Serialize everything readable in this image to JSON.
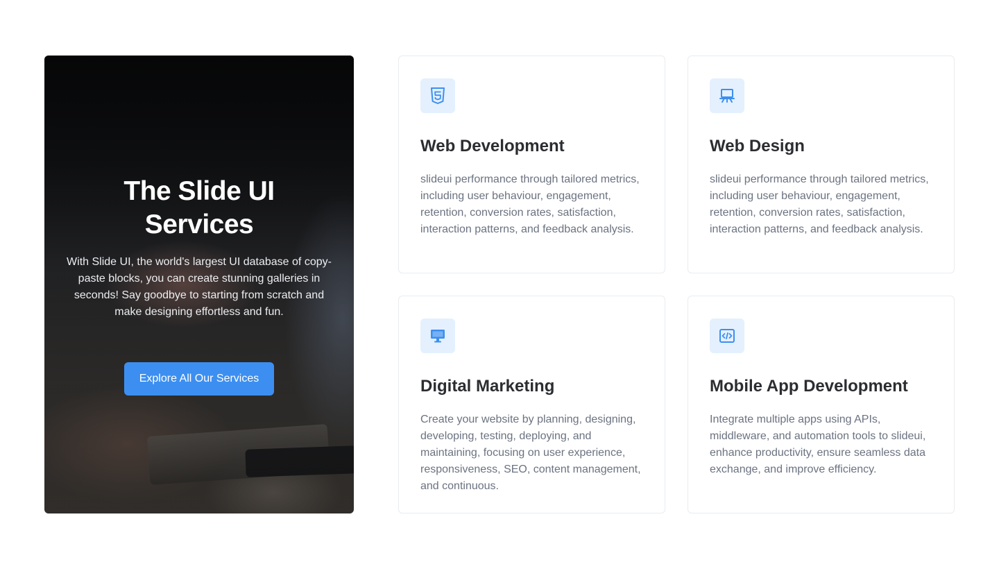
{
  "hero": {
    "title": "The Slide UI Services",
    "description": "With Slide UI, the world's largest UI database of copy-paste blocks, you can create stunning galleries in seconds! Say goodbye to starting from scratch and make designing effortless and fun.",
    "button_label": "Explore All Our Services"
  },
  "services": [
    {
      "title": "Web Development",
      "description": "slideui performance through tailored metrics, including user behaviour, engagement, retention, conversion rates, satisfaction, interaction patterns, and feedback analysis.",
      "icon": "html5-icon"
    },
    {
      "title": "Web Design",
      "description": "slideui performance through tailored metrics, including user behaviour, engagement, retention, conversion rates, satisfaction, interaction patterns, and feedback analysis.",
      "icon": "presentation-board-icon"
    },
    {
      "title": "Digital Marketing",
      "description": "Create your website by planning, designing, developing, testing, deploying, and maintaining, focusing on user experience, responsiveness, SEO, content management, and continuous.",
      "icon": "monitor-icon"
    },
    {
      "title": "Mobile App Development",
      "description": "Integrate multiple apps using APIs, middleware, and automation tools to slideui, enhance productivity, ensure seamless data exchange, and improve efficiency.",
      "icon": "code-window-icon"
    }
  ],
  "colors": {
    "accent": "#3c8ff0",
    "icon_bg": "#e4f0fd",
    "heading": "#2b2d31",
    "body_text": "#6b7280",
    "card_border": "#e9ecef"
  }
}
